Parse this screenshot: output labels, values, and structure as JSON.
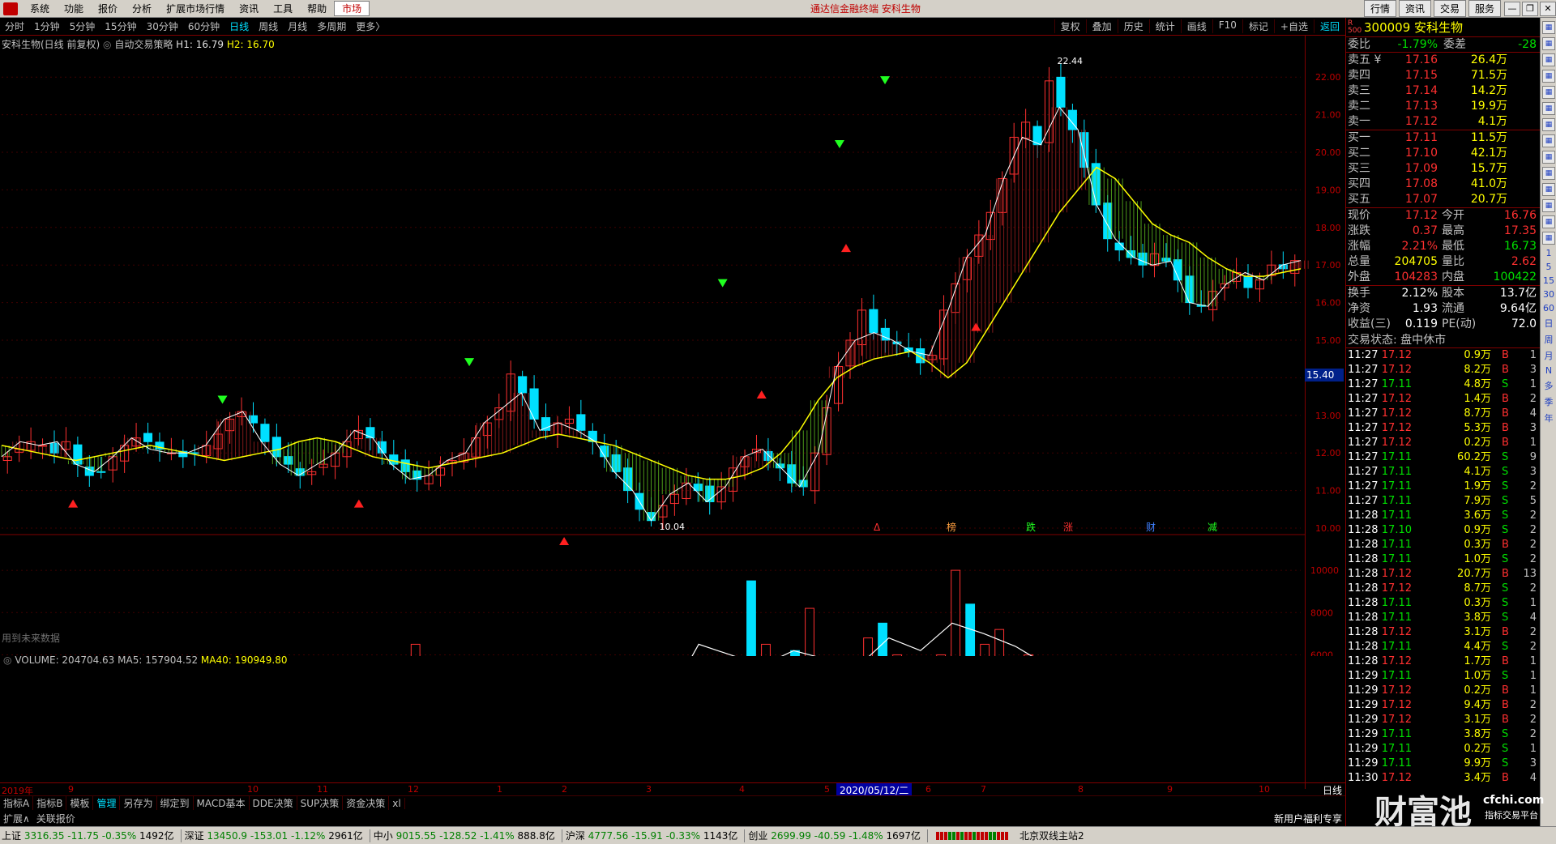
{
  "menu": {
    "items": [
      "系统",
      "功能",
      "报价",
      "分析",
      "扩展市场行情",
      "资讯",
      "工具",
      "帮助"
    ],
    "active": "市场",
    "center_title": "通达信金融终端  安科生物",
    "right_buttons": [
      "行情",
      "资讯",
      "交易",
      "服务"
    ]
  },
  "periods": {
    "items": [
      "分时",
      "1分钟",
      "5分钟",
      "15分钟",
      "30分钟",
      "60分钟",
      "日线",
      "周线",
      "月线",
      "多周期",
      "更多〉"
    ],
    "active": "日线",
    "tools": [
      "复权",
      "叠加",
      "历史",
      "统计",
      "画线",
      "F10",
      "标记",
      "+自选",
      "返回"
    ]
  },
  "chart_title": {
    "name": "安科生物(日线 前复权)",
    "strategy": "自动交易策略",
    "h1": "H1: 16.79",
    "h2": "H2: 16.70"
  },
  "future_note": "用到未来数据",
  "volume_title": {
    "vol": "VOLUME: 204704.63",
    "ma5": "MA5: 157904.52",
    "ma40": "MA40: 190949.80"
  },
  "price_axis": {
    "ticks": [
      "22.00",
      "21.00",
      "20.00",
      "19.00",
      "18.00",
      "17.00",
      "16.00",
      "15.00",
      "14.00",
      "13.00",
      "12.00",
      "11.00",
      "10.00"
    ],
    "current_tag": "15.40",
    "high_label": "22.44",
    "low_label": "10.04"
  },
  "volume_axis": {
    "ticks": [
      "10000",
      "8000",
      "6000",
      "4000",
      "2000"
    ],
    "unit": "X100"
  },
  "date_axis": {
    "labels": [
      "2019年",
      "9",
      "10",
      "11",
      "12",
      "1",
      "2",
      "3",
      "4",
      "5",
      "6",
      "7",
      "8",
      "9",
      "10"
    ],
    "selected": "2020/05/12/二",
    "period": "日线"
  },
  "event_markers": [
    "Δ",
    "榜",
    "跌",
    "涨",
    "财",
    "减"
  ],
  "indicator_tabs": [
    "指标A",
    "指标B",
    "模板",
    "管理",
    "另存为",
    "绑定到",
    "MACD基本",
    "DDE决策",
    "SUP决策",
    "资金决策",
    "xl"
  ],
  "indicator_active": "管理",
  "sub_tabs": [
    "扩展∧",
    "关联报价"
  ],
  "promo": "新用户福利专享",
  "mini_tabs": [
    "笔",
    "价",
    "细",
    "势",
    "联",
    "值",
    "主"
  ],
  "quote": {
    "badge": "R 500",
    "code_name": "300009 安科生物",
    "weibi_label": "委比",
    "weibi": "-1.79%",
    "weicha_label": "委差",
    "weicha": "-28",
    "asks": [
      {
        "label": "卖五 ¥",
        "price": "17.16",
        "vol": "26.4万"
      },
      {
        "label": "卖四",
        "price": "17.15",
        "vol": "71.5万"
      },
      {
        "label": "卖三",
        "price": "17.14",
        "vol": "14.2万"
      },
      {
        "label": "卖二",
        "price": "17.13",
        "vol": "19.9万"
      },
      {
        "label": "卖一",
        "price": "17.12",
        "vol": "4.1万"
      }
    ],
    "bids": [
      {
        "label": "买一",
        "price": "17.11",
        "vol": "11.5万"
      },
      {
        "label": "买二",
        "price": "17.10",
        "vol": "42.1万"
      },
      {
        "label": "买三",
        "price": "17.09",
        "vol": "15.7万"
      },
      {
        "label": "买四",
        "price": "17.08",
        "vol": "41.0万"
      },
      {
        "label": "买五",
        "price": "17.07",
        "vol": "20.7万"
      }
    ],
    "stats": [
      {
        "l1": "现价",
        "v1": "17.12",
        "c1": "red",
        "l2": "今开",
        "v2": "16.76",
        "c2": "red"
      },
      {
        "l1": "涨跌",
        "v1": "0.37",
        "c1": "red",
        "l2": "最高",
        "v2": "17.35",
        "c2": "red"
      },
      {
        "l1": "涨幅",
        "v1": "2.21%",
        "c1": "red",
        "l2": "最低",
        "v2": "16.73",
        "c2": "grn"
      },
      {
        "l1": "总量",
        "v1": "204705",
        "c1": "yel",
        "l2": "量比",
        "v2": "2.62",
        "c2": "red"
      },
      {
        "l1": "外盘",
        "v1": "104283",
        "c1": "red",
        "l2": "内盘",
        "v2": "100422",
        "c2": "grn"
      }
    ],
    "stats2": [
      {
        "l1": "换手",
        "v1": "2.12%",
        "l2": "股本",
        "v2": "13.7亿"
      },
      {
        "l1": "净资",
        "v1": "1.93",
        "l2": "流通",
        "v2": "9.64亿"
      },
      {
        "l1": "收益(三)",
        "v1": "0.119",
        "l2": "PE(动)",
        "v2": "72.0"
      }
    ],
    "trade_status": "交易状态: 盘中休市"
  },
  "ticks": [
    {
      "t": "11:27",
      "p": "17.12",
      "v": "0.9万",
      "bs": "B",
      "n": "1"
    },
    {
      "t": "11:27",
      "p": "17.12",
      "v": "8.2万",
      "bs": "B",
      "n": "3"
    },
    {
      "t": "11:27",
      "p": "17.11",
      "v": "4.8万",
      "bs": "S",
      "n": "1"
    },
    {
      "t": "11:27",
      "p": "17.12",
      "v": "1.4万",
      "bs": "B",
      "n": "2"
    },
    {
      "t": "11:27",
      "p": "17.12",
      "v": "8.7万",
      "bs": "B",
      "n": "4"
    },
    {
      "t": "11:27",
      "p": "17.12",
      "v": "5.3万",
      "bs": "B",
      "n": "3"
    },
    {
      "t": "11:27",
      "p": "17.12",
      "v": "0.2万",
      "bs": "B",
      "n": "1"
    },
    {
      "t": "11:27",
      "p": "17.11",
      "v": "60.2万",
      "bs": "S",
      "n": "9"
    },
    {
      "t": "11:27",
      "p": "17.11",
      "v": "4.1万",
      "bs": "S",
      "n": "3"
    },
    {
      "t": "11:27",
      "p": "17.11",
      "v": "1.9万",
      "bs": "S",
      "n": "2"
    },
    {
      "t": "11:27",
      "p": "17.11",
      "v": "7.9万",
      "bs": "S",
      "n": "5"
    },
    {
      "t": "11:28",
      "p": "17.11",
      "v": "3.6万",
      "bs": "S",
      "n": "2"
    },
    {
      "t": "11:28",
      "p": "17.10",
      "v": "0.9万",
      "bs": "S",
      "n": "2"
    },
    {
      "t": "11:28",
      "p": "17.11",
      "v": "0.3万",
      "bs": "B",
      "n": "2"
    },
    {
      "t": "11:28",
      "p": "17.11",
      "v": "1.0万",
      "bs": "S",
      "n": "2"
    },
    {
      "t": "11:28",
      "p": "17.12",
      "v": "20.7万",
      "bs": "B",
      "n": "13"
    },
    {
      "t": "11:28",
      "p": "17.12",
      "v": "8.7万",
      "bs": "S",
      "n": "2"
    },
    {
      "t": "11:28",
      "p": "17.11",
      "v": "0.3万",
      "bs": "S",
      "n": "1"
    },
    {
      "t": "11:28",
      "p": "17.11",
      "v": "3.8万",
      "bs": "S",
      "n": "4"
    },
    {
      "t": "11:28",
      "p": "17.12",
      "v": "3.1万",
      "bs": "B",
      "n": "2"
    },
    {
      "t": "11:28",
      "p": "17.11",
      "v": "4.4万",
      "bs": "S",
      "n": "2"
    },
    {
      "t": "11:28",
      "p": "17.12",
      "v": "1.7万",
      "bs": "B",
      "n": "1"
    },
    {
      "t": "11:29",
      "p": "17.11",
      "v": "1.0万",
      "bs": "S",
      "n": "1"
    },
    {
      "t": "11:29",
      "p": "17.12",
      "v": "0.2万",
      "bs": "B",
      "n": "1"
    },
    {
      "t": "11:29",
      "p": "17.12",
      "v": "9.4万",
      "bs": "B",
      "n": "2"
    },
    {
      "t": "11:29",
      "p": "17.12",
      "v": "3.1万",
      "bs": "B",
      "n": "2"
    },
    {
      "t": "11:29",
      "p": "17.11",
      "v": "3.8万",
      "bs": "S",
      "n": "2"
    },
    {
      "t": "11:29",
      "p": "17.11",
      "v": "0.2万",
      "bs": "S",
      "n": "1"
    },
    {
      "t": "11:29",
      "p": "17.11",
      "v": "9.9万",
      "bs": "S",
      "n": "3"
    },
    {
      "t": "11:30",
      "p": "17.12",
      "v": "3.4万",
      "bs": "B",
      "n": "4"
    }
  ],
  "iconstrip_labels": [
    "1",
    "5",
    "15",
    "30",
    "60",
    "日",
    "周",
    "月",
    "N",
    "多",
    "季",
    "年"
  ],
  "statusbar": {
    "indices": [
      {
        "name": "上证",
        "val": "3316.35",
        "chg": "-11.75",
        "pct": "-0.35%",
        "amt": "1492亿"
      },
      {
        "name": "深证",
        "val": "13450.9",
        "chg": "-153.01",
        "pct": "-1.12%",
        "amt": "2961亿"
      },
      {
        "name": "中小",
        "val": "9015.55",
        "chg": "-128.52",
        "pct": "-1.41%",
        "amt": "888.8亿"
      },
      {
        "name": "沪深",
        "val": "4777.56",
        "chg": "-15.91",
        "pct": "-0.33%",
        "amt": "1143亿"
      },
      {
        "name": "创业",
        "val": "2699.99",
        "chg": "-40.59",
        "pct": "-1.48%",
        "amt": "1697亿"
      }
    ],
    "server": "北京双线主站2"
  },
  "watermark": {
    "main": "财富池",
    "sub": "cfchi.com",
    "sub2": "指标交易平台"
  },
  "colors": {
    "up": "#ff3030",
    "down": "#00e0ff",
    "ma_fill_up": "#a02020",
    "ma_fill_down": "#60c020",
    "ma_line": "#ffff00",
    "bg": "#000000",
    "grid": "#800000"
  },
  "chart_data": {
    "type": "candlestick",
    "title": "安科生物(日线 前复权)",
    "ylim": [
      10.0,
      22.5
    ],
    "x_months": [
      "2019年",
      "9",
      "10",
      "11",
      "12",
      "1",
      "2",
      "3",
      "4",
      "5",
      "6",
      "7",
      "8",
      "9",
      "10"
    ],
    "close_series": [
      11.9,
      12.1,
      12.3,
      12.2,
      12.0,
      12.3,
      11.7,
      11.4,
      11.5,
      11.9,
      12.2,
      12.4,
      12.3,
      12.1,
      12.0,
      11.9,
      12.0,
      12.2,
      12.5,
      12.9,
      13.1,
      12.8,
      12.3,
      11.9,
      11.7,
      11.4,
      11.5,
      11.7,
      12.0,
      12.3,
      12.6,
      12.4,
      12.0,
      11.7,
      11.5,
      11.3,
      11.4,
      11.6,
      11.8,
      12.0,
      12.4,
      12.8,
      13.2,
      14.1,
      13.6,
      12.9,
      12.6,
      12.8,
      12.9,
      12.6,
      12.3,
      11.9,
      11.5,
      11.0,
      10.5,
      10.2,
      10.6,
      10.9,
      11.2,
      11.0,
      10.7,
      11.1,
      11.6,
      11.9,
      12.1,
      11.8,
      11.6,
      11.2,
      11.1,
      12.0,
      13.2,
      14.3,
      15.0,
      15.8,
      15.2,
      15.0,
      14.9,
      14.7,
      14.4,
      14.6,
      15.8,
      16.5,
      17.2,
      17.8,
      18.4,
      19.3,
      20.4,
      20.8,
      20.2,
      21.9,
      21.2,
      20.6,
      19.6,
      18.6,
      17.7,
      17.4,
      17.2,
      17.0,
      17.3,
      17.1,
      16.6,
      16.0,
      15.9,
      16.3,
      16.5,
      16.8,
      16.4,
      16.6,
      17.0,
      16.9,
      17.12
    ],
    "ma_series": [
      12.2,
      12.1,
      12.0,
      11.9,
      11.8,
      11.9,
      12.0,
      12.1,
      12.2,
      12.1,
      12.0,
      11.9,
      11.8,
      11.9,
      12.0,
      12.1,
      12.3,
      12.4,
      12.3,
      12.1,
      11.9,
      11.8,
      11.7,
      11.6,
      11.7,
      11.8,
      11.9,
      12.0,
      12.2,
      12.4,
      12.5,
      12.4,
      12.3,
      12.2,
      12.0,
      11.8,
      11.6,
      11.4,
      11.3,
      11.3,
      11.4,
      11.6,
      12.0,
      12.6,
      13.4,
      14.0,
      14.3,
      14.5,
      14.6,
      14.7,
      14.4,
      14.0,
      14.4,
      15.2,
      16.0,
      16.8,
      17.6,
      18.4,
      19.0,
      19.6,
      19.3,
      18.7,
      18.1,
      17.8,
      17.6,
      17.2,
      16.9,
      16.7,
      16.7,
      16.8,
      16.9
    ],
    "high": 22.44,
    "low": 10.04,
    "current": 17.12,
    "buy_signals": [
      11.0,
      11.0,
      10.0,
      13.9,
      17.8,
      15.7
    ],
    "sell_signals": [
      13.2,
      14.2,
      16.3,
      20.0,
      21.7
    ],
    "volume": {
      "ylim": [
        0,
        11000
      ],
      "ticks": [
        10000,
        8000,
        6000,
        4000,
        2000
      ],
      "series": [
        {
          "name": "VOLUME",
          "values": [
            800,
            900,
            1000,
            850,
            700,
            650,
            900,
            1200,
            800,
            600,
            700,
            1500,
            900,
            800,
            1100,
            2500,
            1300,
            1000,
            900,
            800,
            1100,
            3500,
            2200,
            1500,
            1200,
            1000,
            900,
            4500,
            6500,
            3800,
            2000,
            1800,
            1500,
            1200,
            1000,
            900,
            1600,
            3800,
            2200,
            1400,
            1200,
            900,
            2400,
            4200,
            2600,
            2000,
            2800,
            1400,
            1200,
            1000,
            1500,
            9500,
            6500,
            5200,
            6200,
            8200,
            5600,
            4000,
            3500,
            6800,
            7500,
            6000,
            5200,
            4500,
            6000,
            10000,
            8400,
            6500,
            7200,
            5500,
            6000,
            4500,
            3500,
            2500,
            3000,
            4800,
            2600,
            3200,
            2800,
            2400,
            2600,
            3200,
            3000,
            2500,
            2200,
            2000,
            2400,
            2600,
            2500
          ]
        },
        {
          "name": "MA5",
          "values": [
            850,
            900,
            950,
            1050,
            1300,
            1700,
            1500,
            1400,
            2500,
            3500,
            3200,
            2400,
            1800,
            1700,
            2000,
            2800,
            2600,
            2200,
            3000,
            3300,
            2600,
            3800,
            6500,
            6000,
            5500,
            6200,
            5800,
            5400,
            6800,
            6200,
            7500,
            7000,
            6400,
            5500,
            4500,
            3600,
            3200,
            3100,
            2800,
            2700,
            2500,
            2400
          ]
        },
        {
          "name": "MA40",
          "values": [
            1200,
            1300,
            1400,
            1600,
            1800,
            2000,
            2200,
            2400,
            2600,
            2800,
            3000,
            3300,
            3800,
            4300,
            4800,
            5200,
            5400,
            5500,
            5300,
            5000,
            4600,
            4200,
            3800,
            3400,
            3000,
            2700,
            2500
          ]
        }
      ]
    }
  }
}
